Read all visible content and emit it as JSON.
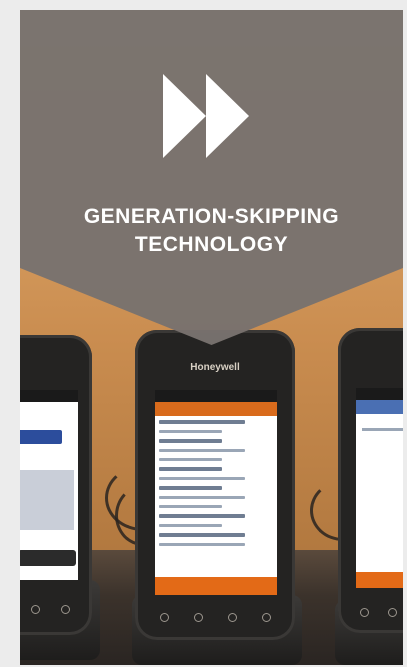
{
  "banner": {
    "icon": "fast-forward-icon",
    "headline_line1": "GENERATION-SKIPPING",
    "headline_line2": "TECHNOLOGY",
    "background_color": "#78726e",
    "text_color": "#ffffff"
  },
  "photo": {
    "center_phone_brand": "Honeywell"
  }
}
